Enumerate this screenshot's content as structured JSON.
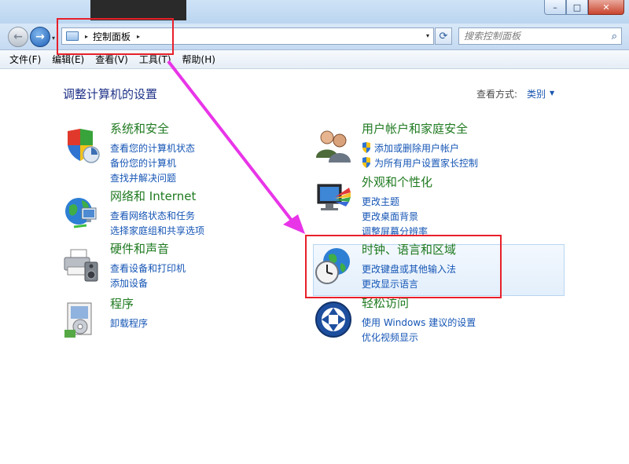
{
  "window": {
    "minimize_glyph": "–",
    "maximize_glyph": "□",
    "close_glyph": "✕"
  },
  "nav": {
    "back_glyph": "←",
    "forward_glyph": "→",
    "dropdown_glyph": "▾"
  },
  "address_bar": {
    "arrow_glyph": "▸",
    "path_label": "控制面板",
    "trailing_arrow_glyph": "▸",
    "dropdown_glyph": "▾"
  },
  "refresh": {
    "glyph": "⟳"
  },
  "search": {
    "placeholder": "搜索控制面板",
    "icon_glyph": "⌕"
  },
  "menubar": {
    "items": [
      "文件(F)",
      "编辑(E)",
      "查看(V)",
      "工具(T)",
      "帮助(H)"
    ]
  },
  "content": {
    "title": "调整计算机的设置",
    "view_by_label": "查看方式:",
    "view_by_value": "类别",
    "view_by_arrow": "▼"
  },
  "categories": {
    "system_security": {
      "title": "系统和安全",
      "links": [
        "查看您的计算机状态",
        "备份您的计算机",
        "查找并解决问题"
      ],
      "icon": "shield-icon"
    },
    "network": {
      "title": "网络和 Internet",
      "links": [
        "查看网络状态和任务",
        "选择家庭组和共享选项"
      ],
      "icon": "globe-network-icon"
    },
    "hardware": {
      "title": "硬件和声音",
      "links": [
        "查看设备和打印机",
        "添加设备"
      ],
      "icon": "printer-icon"
    },
    "programs": {
      "title": "程序",
      "links": [
        "卸载程序"
      ],
      "icon": "programs-icon"
    },
    "user_accounts": {
      "title": "用户帐户和家庭安全",
      "links": [
        "添加或删除用户帐户",
        "为所有用户设置家长控制"
      ],
      "icon": "users-icon"
    },
    "appearance": {
      "title": "外观和个性化",
      "links": [
        "更改主题",
        "更改桌面背景",
        "调整屏幕分辨率"
      ],
      "icon": "monitor-palette-icon"
    },
    "clock_region": {
      "title": "时钟、语言和区域",
      "links": [
        "更改键盘或其他输入法",
        "更改显示语言"
      ],
      "icon": "clock-globe-icon"
    },
    "ease_of_access": {
      "title": "轻松访问",
      "links": [
        "使用 Windows 建议的设置",
        "优化视频显示"
      ],
      "icon": "ease-of-access-icon"
    }
  },
  "colors": {
    "category_title": "#1f7a20",
    "link": "#1555b5",
    "annotation": "#e8202a",
    "arrow": "#e835e8"
  }
}
